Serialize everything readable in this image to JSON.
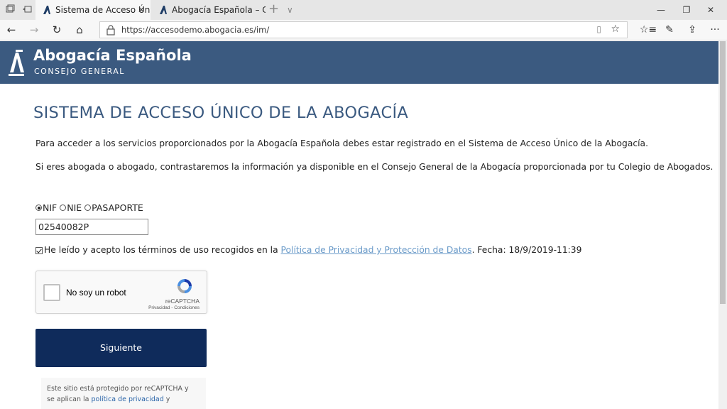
{
  "browser": {
    "tabs": [
      {
        "title": "Sistema de Acceso Únic",
        "close": "✕",
        "active": true
      },
      {
        "title": "Abogacía Española – Conse",
        "active": false
      }
    ],
    "new_tab": "+",
    "tab_dropdown": "∨",
    "window": {
      "minimize": "—",
      "maximize": "❐",
      "close": "✕"
    },
    "nav": {
      "back": "←",
      "forward": "→",
      "refresh": "↻",
      "home": "⌂"
    },
    "url": "https://accesodemo.abogacia.es/im/",
    "reading_view": "▯",
    "favorite": "☆",
    "right_icons": {
      "favorites": "☆≡",
      "notes": "✎",
      "share": "⇪",
      "more": "···"
    }
  },
  "colors": {
    "header_bg": "#3b5a80",
    "button_bg": "#0f2b5b",
    "link": "#6b9bc9",
    "title": "#3b5a80"
  },
  "header": {
    "brand": "Abogacía Española",
    "subtitle": "CONSEJO GENERAL"
  },
  "main": {
    "title": "SISTEMA DE ACCESO ÚNICO DE LA ABOGACÍA",
    "para1": "Para acceder a los servicios proporcionados por la Abogacía Española debes estar registrado en el Sistema de Acceso Único de la Abogacía.",
    "para2": "Si eres abogada o abogado, contrastaremos la información ya disponible en el Consejo General de la Abogacía proporcionada por tu Colegio de Abogados.",
    "id_types": [
      {
        "label": "NIF",
        "selected": true
      },
      {
        "label": "NIE",
        "selected": false
      },
      {
        "label": "PASAPORTE",
        "selected": false
      }
    ],
    "id_value": "02540082P",
    "terms": {
      "checked": true,
      "prefix": "He leído y acepto los términos de uso recogidos en la ",
      "link": "Política de Privacidad y Protección de Datos",
      "suffix": ". Fecha: 18/9/2019-11:39"
    },
    "captcha": {
      "label": "No soy un robot",
      "brand": "reCAPTCHA",
      "links": "Privacidad - Condiciones"
    },
    "next_button": "Siguiente",
    "protect": {
      "line1": "Este sitio está protegido por reCAPTCHA y",
      "line2_prefix": "se aplican la ",
      "line2_link": "política de privacidad",
      "line2_suffix": " y"
    }
  }
}
